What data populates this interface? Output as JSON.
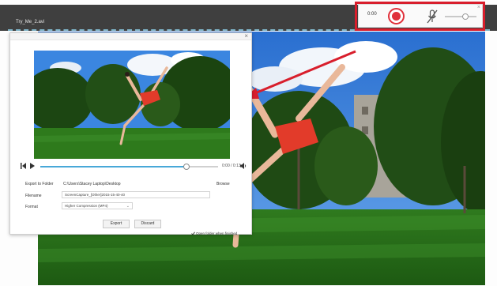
{
  "app": {
    "title": "Try_Me_2.avi"
  },
  "recorder": {
    "time": "0:00",
    "close_glyph": "×",
    "icons": {
      "record": "record-icon",
      "mic": "microphone-muted-icon"
    },
    "highlight_color": "#d81e2c"
  },
  "dialog": {
    "close_glyph": "×",
    "player": {
      "time": "0:00 / 0:13",
      "progress": 0.82,
      "icons": {
        "skip_back": "skip-back-icon",
        "play": "play-icon",
        "volume": "volume-icon"
      }
    },
    "export_folder": {
      "label": "Export to Folder",
      "path": "C:\\Users\\Stacey Laptop\\Desktop",
      "browse_label": "Browse"
    },
    "filename": {
      "label": "Filename",
      "value": "ScreenCapture_[Other]2015-15-40-40"
    },
    "format": {
      "label": "Format",
      "selected": "Higher Compression (MP4)"
    },
    "buttons": {
      "export_label": "Export",
      "discard_label": "Discard"
    },
    "open_folder": {
      "label": "Open folder when finished",
      "checked": true
    }
  },
  "colors": {
    "titlebar": "#3f3f3f",
    "record": "#e0303a",
    "progress": "#48a8d8",
    "callout": "#d81e2c"
  }
}
